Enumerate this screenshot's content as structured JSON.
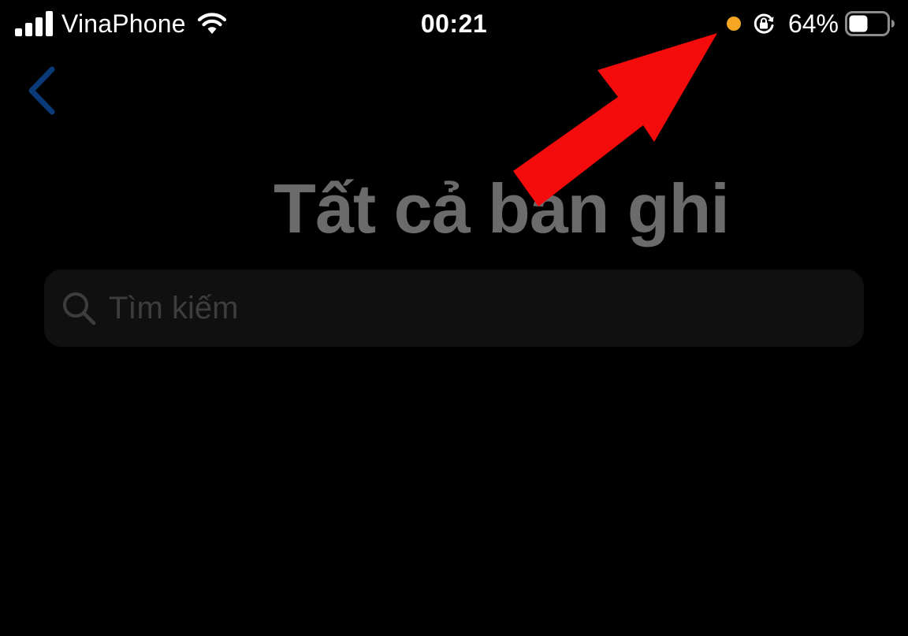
{
  "status_bar": {
    "carrier": "VinaPhone",
    "time": "00:21",
    "battery_percent": "64%",
    "battery_level": 0.64,
    "signal_bars": 4,
    "icons": {
      "signal": "cellular-signal-icon",
      "wifi": "wifi-icon",
      "mic_indicator": "microphone-in-use-dot",
      "rotation_lock": "rotation-lock-icon",
      "battery": "battery-icon"
    },
    "colors": {
      "text": "#ffffff",
      "mic_indicator": "#f5a623"
    }
  },
  "navigation": {
    "back_icon": "chevron-left-icon",
    "back_color": "#0a3a78"
  },
  "page": {
    "title": "Tất cả bản ghi",
    "title_color": "#6b6b6b",
    "background": "#000000"
  },
  "search": {
    "placeholder": "Tìm kiếm",
    "value": "",
    "icon": "search-icon",
    "field_color": "#101010",
    "placeholder_color": "#3d3d3d"
  },
  "annotation": {
    "type": "arrow",
    "color": "#f40b0b",
    "points_to": "microphone-in-use-dot"
  }
}
